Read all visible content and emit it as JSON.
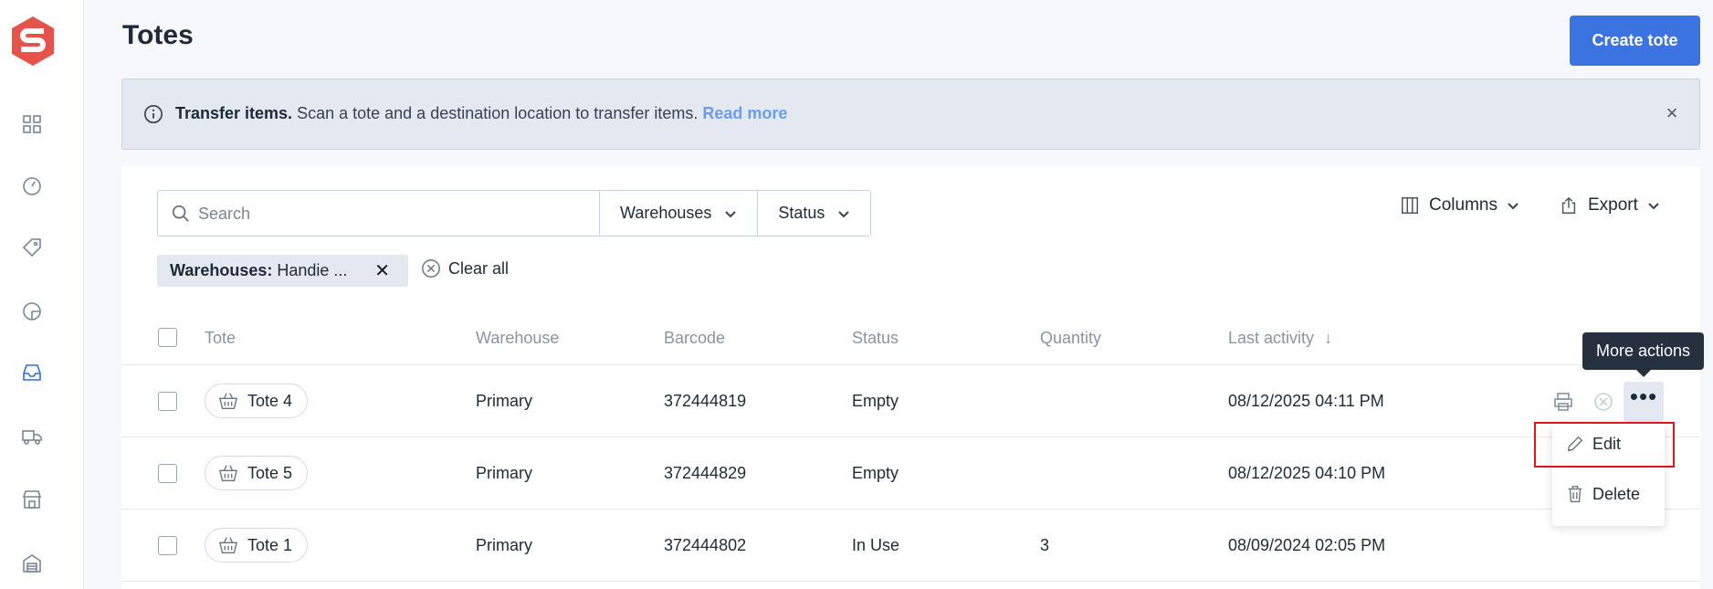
{
  "page": {
    "title": "Totes",
    "create_button": "Create tote"
  },
  "sidebar": {
    "items": [
      {
        "icon": "dashboard-grid-icon"
      },
      {
        "icon": "gauge-icon"
      },
      {
        "icon": "tag-icon"
      },
      {
        "icon": "pie-chart-icon"
      },
      {
        "icon": "inbox-icon",
        "active": true
      },
      {
        "icon": "truck-icon"
      },
      {
        "icon": "store-icon"
      },
      {
        "icon": "warehouse-icon"
      }
    ]
  },
  "banner": {
    "title": "Transfer items.",
    "message": "Scan a tote and a destination location to transfer items.",
    "link": "Read more",
    "close": "×"
  },
  "toolbar": {
    "search_placeholder": "Search",
    "filters": [
      "Warehouses",
      "Status"
    ],
    "columns": "Columns",
    "export": "Export"
  },
  "active_filter": {
    "key": "Warehouses:",
    "value": "Handie ...",
    "remove": "✕",
    "clear_all": "Clear all"
  },
  "table": {
    "headers": {
      "tote": "Tote",
      "warehouse": "Warehouse",
      "barcode": "Barcode",
      "status": "Status",
      "quantity": "Quantity",
      "last_activity": "Last activity"
    },
    "sort_indicator": "↓",
    "rows": [
      {
        "tote": "Tote 4",
        "warehouse": "Primary",
        "barcode": "372444819",
        "status": "Empty",
        "quantity": "",
        "last_activity": "08/12/2025 04:11 PM"
      },
      {
        "tote": "Tote 5",
        "warehouse": "Primary",
        "barcode": "372444829",
        "status": "Empty",
        "quantity": "",
        "last_activity": "08/12/2025 04:10 PM"
      },
      {
        "tote": "Tote 1",
        "warehouse": "Primary",
        "barcode": "372444802",
        "status": "In Use",
        "quantity": "3",
        "last_activity": "08/09/2024 02:05 PM"
      }
    ]
  },
  "tooltip": "More actions",
  "menu": {
    "edit": "Edit",
    "delete": "Delete"
  },
  "colors": {
    "primary": "#3b73e0",
    "highlight": "#e0151e",
    "logo": "#e5534b"
  }
}
